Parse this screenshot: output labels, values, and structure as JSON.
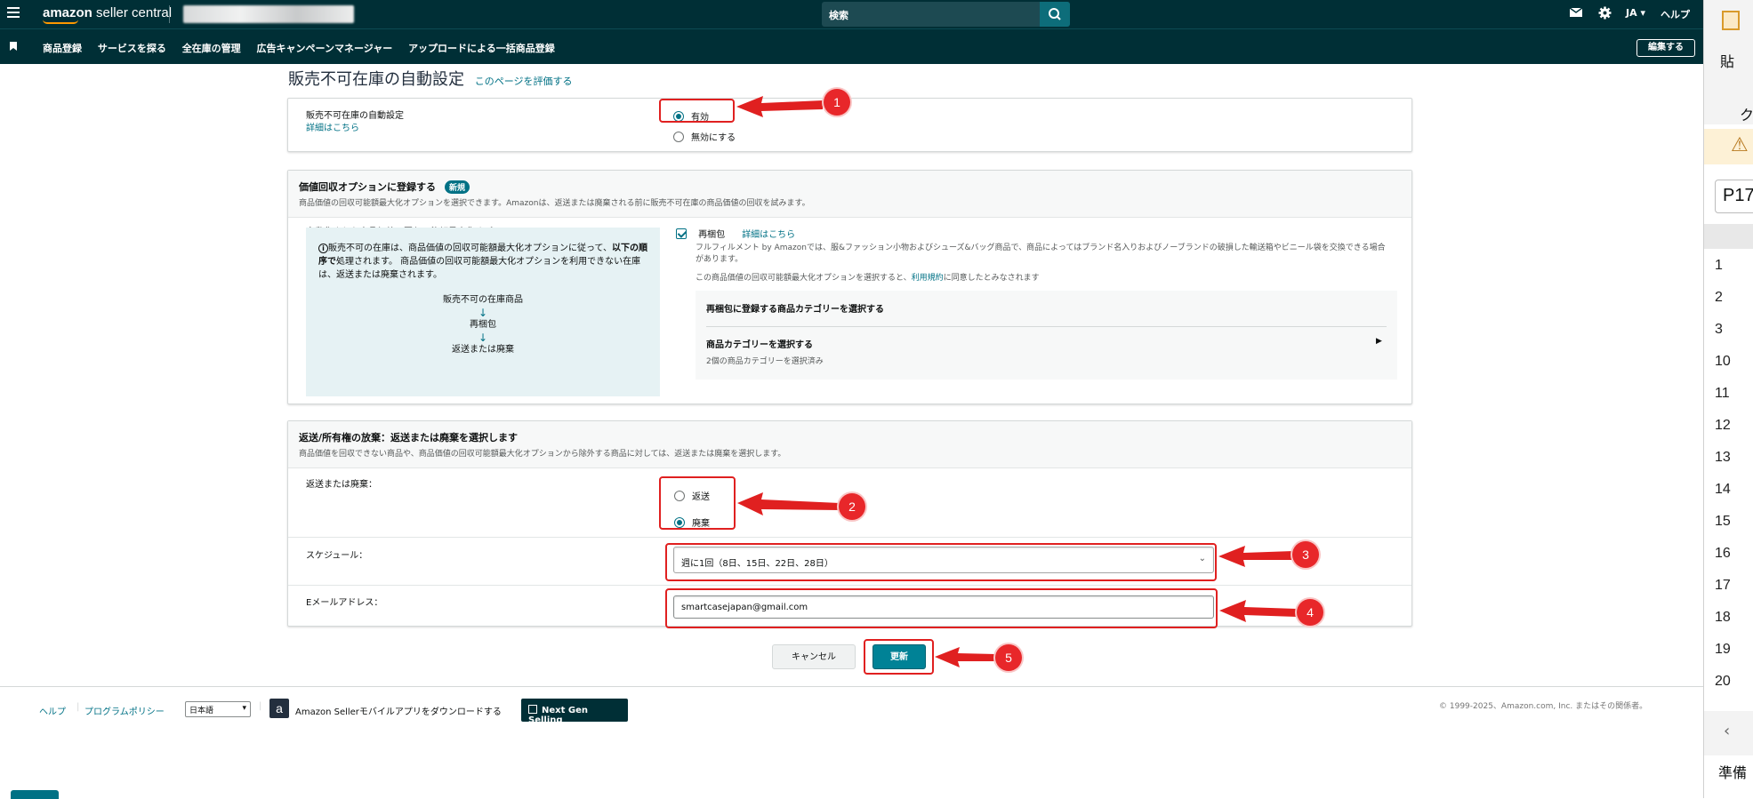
{
  "header": {
    "logo_text_bold": "amazon",
    "logo_text": " seller central",
    "search_placeholder": "検索",
    "language": "JA",
    "help": "ヘルプ"
  },
  "nav": {
    "items": [
      "商品登録",
      "サービスを探る",
      "全在庫の管理",
      "広告キャンペーンマネージャー",
      "アップロードによる一括商品登録"
    ],
    "edit_label": "編集する"
  },
  "page": {
    "title": "販売不可在庫の自動設定",
    "rate_link": "このページを評価する"
  },
  "auto_setting": {
    "label": "販売不可在庫の自動設定",
    "details_link": "詳細はこちら",
    "option_enabled": "有効",
    "option_disabled": "無効にする",
    "selected": "有効"
  },
  "recovery": {
    "title": "価値回収オプションに登録する",
    "new_badge": "新規",
    "description": "商品価値の回収可能額最大化オプションを選択できます。Amazonは、返送または廃棄される前に販売不可在庫の商品価値の回収を試みます。",
    "left_label": "自動化された商品価値の回収可能額最大化オプション",
    "info_text_1": "販売不可の在庫は、商品価値の回収可能額最大化オプションに従って、",
    "info_text_bold": "以下の順序で",
    "info_text_2": "処理されます。 商品価値の回収可能額最大化オプションを利用できない在庫は、返送または廃棄されます。",
    "flow": [
      "販売不可の在庫商品",
      "再梱包",
      "返送または廃棄"
    ],
    "repack_label": "再梱包",
    "repack_details_link": "詳細はこちら",
    "repack_desc": "フルフィルメント by Amazonでは、服&ファッション小物およびシューズ&バッグ商品で、商品によってはブランド名入りおよびノーブランドの破損した輸送箱やビニール袋を交換できる場合があります。",
    "consent_text_1": "この商品価値の回収可能額最大化オプションを選択すると、",
    "consent_link": "利用規約",
    "consent_text_2": "に同意したとみなされます",
    "category_prompt": "再梱包に登録する商品カテゴリーを選択する",
    "category_select_label": "商品カテゴリーを選択する",
    "category_count": "2個の商品カテゴリーを選択済み"
  },
  "disposal": {
    "title": "返送/所有権の放棄：返送または廃棄を選択します",
    "description": "商品価値を回収できない商品や、商品価値の回収可能額最大化オプションから除外する商品に対しては、返送または廃棄を選択します。",
    "choice_label": "返送または廃棄：",
    "option_return": "返送",
    "option_dispose": "廃棄",
    "selected": "廃棄",
    "schedule_label": "スケジュール：",
    "schedule_value": "週に1回（8日、15日、22日、28日）",
    "email_label": "Eメールアドレス：",
    "email_value": "smartcasejapan@gmail.com"
  },
  "actions": {
    "cancel": "キャンセル",
    "update": "更新"
  },
  "annotations": [
    "1",
    "2",
    "3",
    "4",
    "5"
  ],
  "footer": {
    "help": "ヘルプ",
    "policy": "プログラムポリシー",
    "language": "日本語",
    "app_text": "Amazon Sellerモバイルアプリをダウンロードする",
    "next_gen": "Next Gen Selling",
    "copyright": "© 1999-2025、Amazon.com, Inc. またはその関係者。"
  },
  "side_app": {
    "title_fragment": "貼",
    "text_fragment": "ク",
    "cell_ref": "P17",
    "row_numbers": [
      "1",
      "2",
      "3",
      "10",
      "11",
      "12",
      "13",
      "14",
      "15",
      "16",
      "17",
      "18",
      "19",
      "20"
    ],
    "status": "準備"
  },
  "colors": {
    "header_bg": "#002f36",
    "accent": "#007185",
    "annotation_red": "#e02020"
  }
}
